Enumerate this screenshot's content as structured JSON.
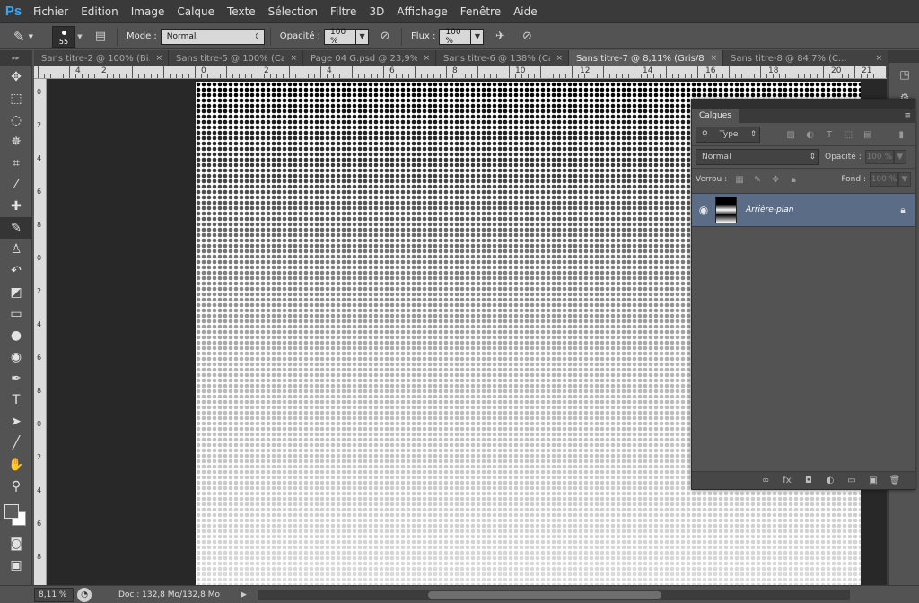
{
  "app": {
    "logo": "Ps"
  },
  "menu": [
    "Fichier",
    "Edition",
    "Image",
    "Calque",
    "Texte",
    "Sélection",
    "Filtre",
    "3D",
    "Affichage",
    "Fenêtre",
    "Aide"
  ],
  "options": {
    "brush_size": "55",
    "mode_label": "Mode :",
    "mode_value": "Normal",
    "opacity_label": "Opacité :",
    "opacity_value": "100 %",
    "flow_label": "Flux :",
    "flow_value": "100 %"
  },
  "tabs": [
    {
      "label": "Sans titre-2 @ 100% (Bi...",
      "close": "×"
    },
    {
      "label": "Sans titre-5 @ 100% (Ca...",
      "close": "×"
    },
    {
      "label": "Page 04 G.psd @ 23,9%...",
      "close": "×"
    },
    {
      "label": "Sans titre-6 @ 138% (Ca...",
      "close": "×"
    },
    {
      "label": "Sans titre-7 @ 8,11% (Gris/8) *",
      "close": "×"
    },
    {
      "label": "Sans titre-8 @ 84,7% (C...",
      "close": "×"
    }
  ],
  "ruler_top": [
    "4",
    "2",
    "0",
    "2",
    "4",
    "6",
    "8",
    "10",
    "12",
    "14",
    "16",
    "18",
    "20",
    "21"
  ],
  "ruler_left": [
    "0",
    "2",
    "4",
    "6",
    "8",
    "0",
    "2",
    "4",
    "6",
    "8",
    "0",
    "2",
    "4",
    "6",
    "8"
  ],
  "tools": [
    {
      "name": "move-tool-icon",
      "glyph": "✥"
    },
    {
      "name": "marquee-tool-icon",
      "glyph": "⬚"
    },
    {
      "name": "lasso-tool-icon",
      "glyph": "◌"
    },
    {
      "name": "magic-wand-tool-icon",
      "glyph": "✵"
    },
    {
      "name": "crop-tool-icon",
      "glyph": "⌗"
    },
    {
      "name": "eyedropper-tool-icon",
      "glyph": "⁄"
    },
    {
      "name": "healing-brush-tool-icon",
      "glyph": "✚"
    },
    {
      "name": "brush-tool-icon",
      "glyph": "✎"
    },
    {
      "name": "clone-stamp-tool-icon",
      "glyph": "♙"
    },
    {
      "name": "history-brush-tool-icon",
      "glyph": "↶"
    },
    {
      "name": "eraser-tool-icon",
      "glyph": "◩"
    },
    {
      "name": "gradient-tool-icon",
      "glyph": "▭"
    },
    {
      "name": "blur-tool-icon",
      "glyph": "●"
    },
    {
      "name": "dodge-tool-icon",
      "glyph": "◉"
    },
    {
      "name": "pen-tool-icon",
      "glyph": "✒"
    },
    {
      "name": "type-tool-icon",
      "glyph": "T"
    },
    {
      "name": "path-selection-tool-icon",
      "glyph": "➤"
    },
    {
      "name": "line-tool-icon",
      "glyph": "╱"
    },
    {
      "name": "hand-tool-icon",
      "glyph": "✋"
    },
    {
      "name": "zoom-tool-icon",
      "glyph": "⚲"
    }
  ],
  "layers_panel": {
    "tab": "Calques",
    "filter_type": "Type",
    "blend_mode": "Normal",
    "opacity_label": "Opacité :",
    "opacity_value": "100 %",
    "lock_label": "Verrou :",
    "fill_label": "Fond :",
    "fill_value": "100 %",
    "layers": [
      {
        "name": "Arrière-plan",
        "selected": true,
        "locked": true
      }
    ]
  },
  "status": {
    "zoom": "8,11 %",
    "doc_info": "Doc : 132,8 Mo/132,8 Mo"
  },
  "colors": {
    "accent_logo": "#31a8ff",
    "selected_layer": "#5b6c87"
  }
}
